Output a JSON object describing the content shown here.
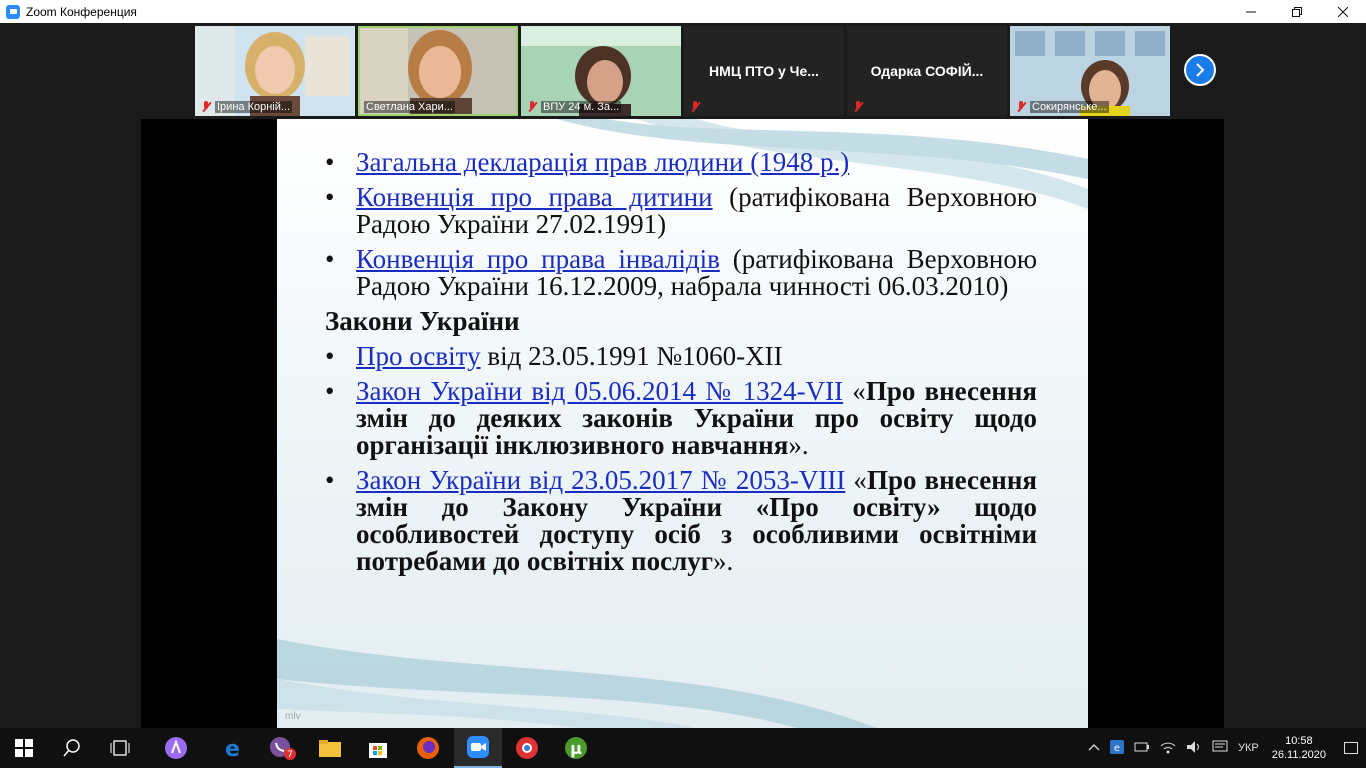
{
  "window": {
    "title": "Zoom Конференция"
  },
  "participants": [
    {
      "name": "Ірина Корній...",
      "muted": true,
      "video": true
    },
    {
      "name": "Светлана Хари...",
      "muted": false,
      "video": true,
      "active": true
    },
    {
      "name": "ВПУ 24 м. За...",
      "muted": true,
      "video": true
    },
    {
      "name": "НМЦ  ПТО у Че...",
      "muted": true,
      "video": false
    },
    {
      "name": "Одарка  СОФІЙ...",
      "muted": true,
      "video": false
    },
    {
      "name": "Сокирянське...",
      "muted": true,
      "video": true
    }
  ],
  "slide": {
    "item1_link": "Загальна декларація прав людини (1948 р.)",
    "item2_link": "Конвенція про права дитини",
    "item2_rest": " (ратифікована Верховною Радою України 27.02.1991)",
    "item3_link": "Конвенція про права інвалідів",
    "item3_rest": " (ратифікована Верховною Радою України 16.12.2009, набрала чинності 06.03.2010)",
    "section_title": "Закони України",
    "item4_link": "Про освіту",
    "item4_rest": " від 23.05.1991 №1060-XII",
    "item5_link": "Закон України від 05.06.2014 № 1324-VII",
    "item5_quote_open": " «",
    "item5_bold": "Про внесення змін до деяких законів України про освіту щодо організації інклюзивного навчання",
    "item5_end": "».",
    "item6_link": "Закон України від 23.05.2017 № 2053-VIII",
    "item6_quote_open": " «",
    "item6_bold": "Про внесення змін до Закону України «Про освіту» щодо особливостей доступу осіб з особливими освітніми потребами до освітніх послуг",
    "item6_end": "».",
    "watermark": "mlv"
  },
  "taskbar": {
    "viber_badge": "7",
    "language": "УКР",
    "time": "10:58",
    "date": "26.11.2020"
  }
}
